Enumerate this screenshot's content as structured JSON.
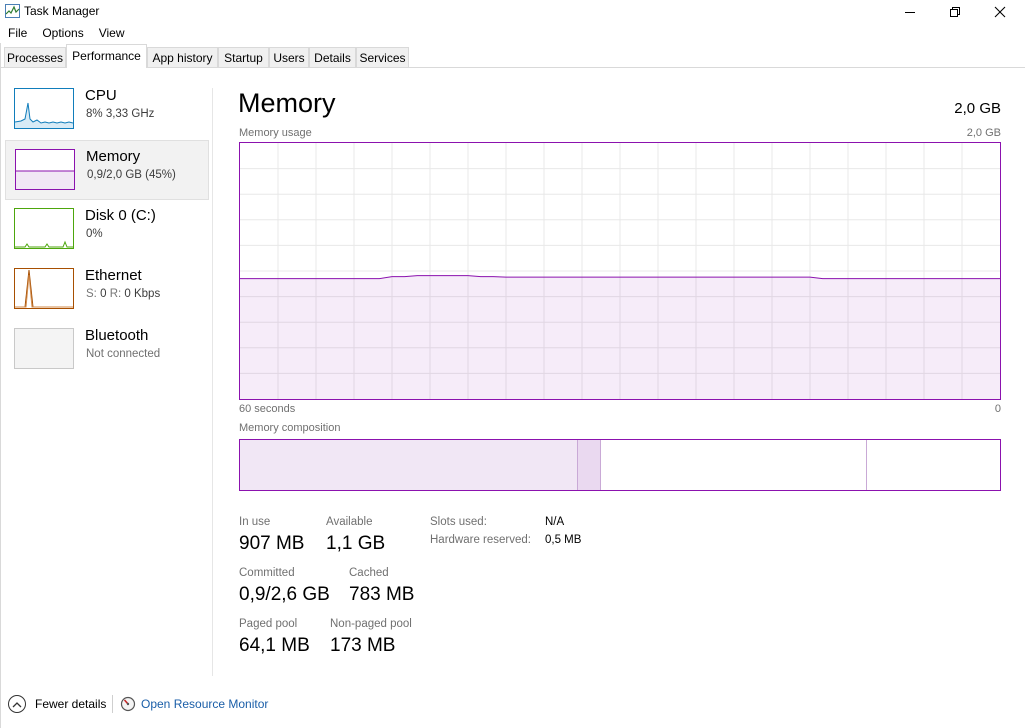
{
  "window": {
    "title": "Task Manager",
    "icons": {
      "app": "task-manager-icon",
      "minimize": "minimize-icon",
      "maximize": "restore-icon",
      "close": "close-icon"
    }
  },
  "menu": [
    "File",
    "Options",
    "View"
  ],
  "tabs": [
    "Processes",
    "Performance",
    "App history",
    "Startup",
    "Users",
    "Details",
    "Services"
  ],
  "active_tab": "Performance",
  "sidebar": {
    "cpu": {
      "title": "CPU",
      "sub": "8% 3,33 GHz",
      "color": "#117dbb"
    },
    "memory": {
      "title": "Memory",
      "sub": "0,9/2,0 GB (45%)",
      "color": "#8b12ae"
    },
    "disk": {
      "title": "Disk 0 (C:)",
      "sub": "0%",
      "color": "#4da60c"
    },
    "ethernet": {
      "title": "Ethernet",
      "send_label": "S:",
      "send_value": "0",
      "recv_label": "R:",
      "recv_value": "0 Kbps",
      "color": "#a74f01"
    },
    "bluetooth": {
      "title": "Bluetooth",
      "sub": "Not connected"
    }
  },
  "main": {
    "title": "Memory",
    "total": "2,0 GB",
    "usage_label": "Memory usage",
    "usage_max": "2,0 GB",
    "time_left": "60 seconds",
    "time_right": "0",
    "composition_label": "Memory composition",
    "usage_fraction": 0.47,
    "composition": {
      "in_use": 0.445,
      "modified": 0.03,
      "standby": 0.35,
      "free": 0.175
    }
  },
  "stats": {
    "in_use": {
      "label": "In use",
      "value": "907 MB"
    },
    "available": {
      "label": "Available",
      "value": "1,1 GB"
    },
    "committed": {
      "label": "Committed",
      "value": "0,9/2,6 GB"
    },
    "cached": {
      "label": "Cached",
      "value": "783 MB"
    },
    "paged_pool": {
      "label": "Paged pool",
      "value": "64,1 MB"
    },
    "non_paged_pool": {
      "label": "Non-paged pool",
      "value": "173 MB"
    },
    "slots_used": {
      "label": "Slots used:",
      "value": "N/A"
    },
    "hardware_reserved": {
      "label": "Hardware reserved:",
      "value": "0,5 MB"
    }
  },
  "footer": {
    "fewer_details": "Fewer details",
    "open_resource_monitor": "Open Resource Monitor",
    "link_color": "#1a5ea8"
  }
}
